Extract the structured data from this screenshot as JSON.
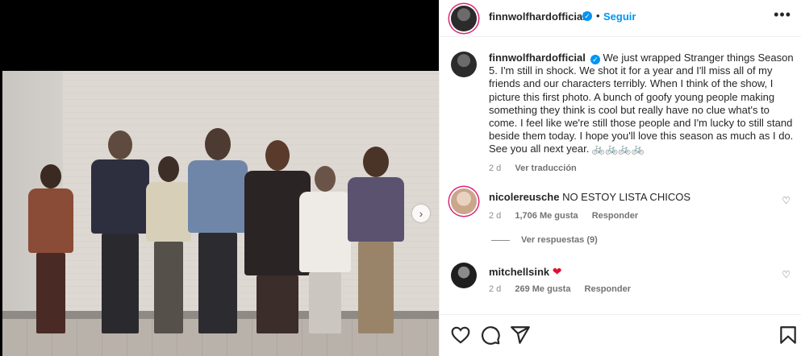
{
  "post": {
    "username": "finnwolfhardofficial",
    "follow_label": "Seguir",
    "separator": "•"
  },
  "caption": {
    "username": "finnwolfhardofficial",
    "text": "We just wrapped Stranger things Season 5. I'm still in shock. We shot it for a year and I'll miss all of my friends and our characters terribly. When I think of the show, I picture this first photo. A bunch of goofy young people making something they think is cool but really have no clue what's to come. I feel like we're still those people and I'm lucky to still stand beside them today. I hope you'll love this season as much as I do. See you all next year. 🚲🚲🚲🚲",
    "time": "2 d",
    "translate_label": "Ver traducción"
  },
  "comments": [
    {
      "username": "nicolereusche",
      "text": "NO ESTOY LISTA CHICOS",
      "time": "2 d",
      "likes": "1,706 Me gusta",
      "reply_label": "Responder",
      "view_replies": "Ver respuestas (9)"
    },
    {
      "username": "mitchellsink",
      "text": "❤",
      "time": "2 d",
      "likes": "269 Me gusta",
      "reply_label": "Responder"
    }
  ],
  "icons": {
    "verified": "verified-badge-icon",
    "more": "more-options-icon",
    "next": "carousel-next-icon",
    "like": "heart-icon",
    "comment": "comment-icon",
    "share": "share-icon",
    "save": "bookmark-icon"
  },
  "colors": {
    "link_blue": "#0095f6",
    "heart_red": "#e0102f"
  }
}
